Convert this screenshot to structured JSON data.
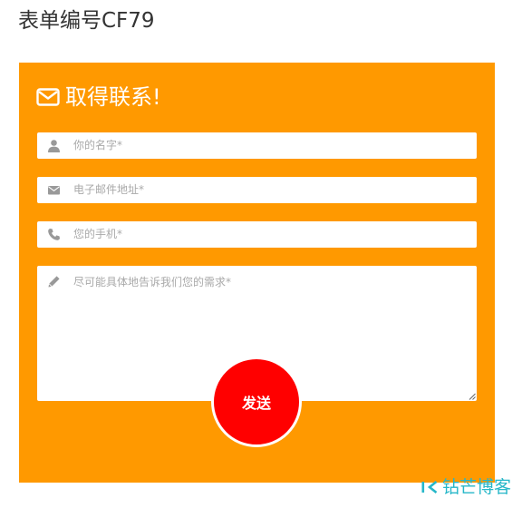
{
  "page": {
    "title": "表单编号CF79"
  },
  "form": {
    "heading": "取得联系!",
    "heading_icon": "envelope-icon",
    "fields": {
      "name": {
        "placeholder": "你的名字*",
        "icon": "user-icon"
      },
      "email": {
        "placeholder": "电子邮件地址*",
        "icon": "mail-icon"
      },
      "phone": {
        "placeholder": "您的手机*",
        "icon": "phone-icon"
      },
      "message": {
        "placeholder": "尽可能具体地告诉我们您的需求*",
        "icon": "pencil-icon"
      }
    },
    "submit_label": "发送"
  },
  "watermark": {
    "text": "钻芒博客"
  },
  "colors": {
    "panel": "#ff9900",
    "submit": "#ff0000",
    "field_icon": "#999999",
    "watermark": "#27b7c9"
  }
}
